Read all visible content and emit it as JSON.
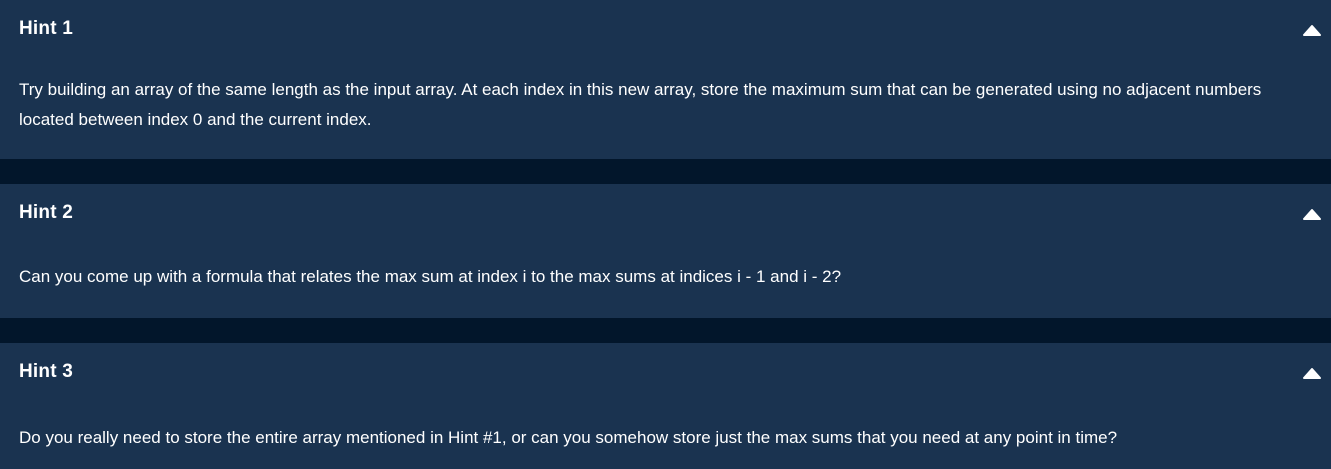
{
  "colors": {
    "page_background": "#02162b",
    "panel_background": "#1a3350",
    "text": "#ffffff"
  },
  "hints": [
    {
      "title": "Hint 1",
      "body": "Try building an array of the same length as the input array. At each index in this new array, store the maximum sum that can be generated using no adjacent numbers located between index 0 and the current index.",
      "toggle_icon": "caret-up-icon",
      "expanded": true
    },
    {
      "title": "Hint 2",
      "body": "Can you come up with a formula that relates the max sum at index i to the max sums at indices i - 1 and i - 2?",
      "toggle_icon": "caret-up-icon",
      "expanded": true
    },
    {
      "title": "Hint 3",
      "body": "Do you really need to store the entire array mentioned in Hint #1, or can you somehow store just the max sums that you need at any point in time?",
      "toggle_icon": "caret-up-icon",
      "expanded": true
    }
  ]
}
